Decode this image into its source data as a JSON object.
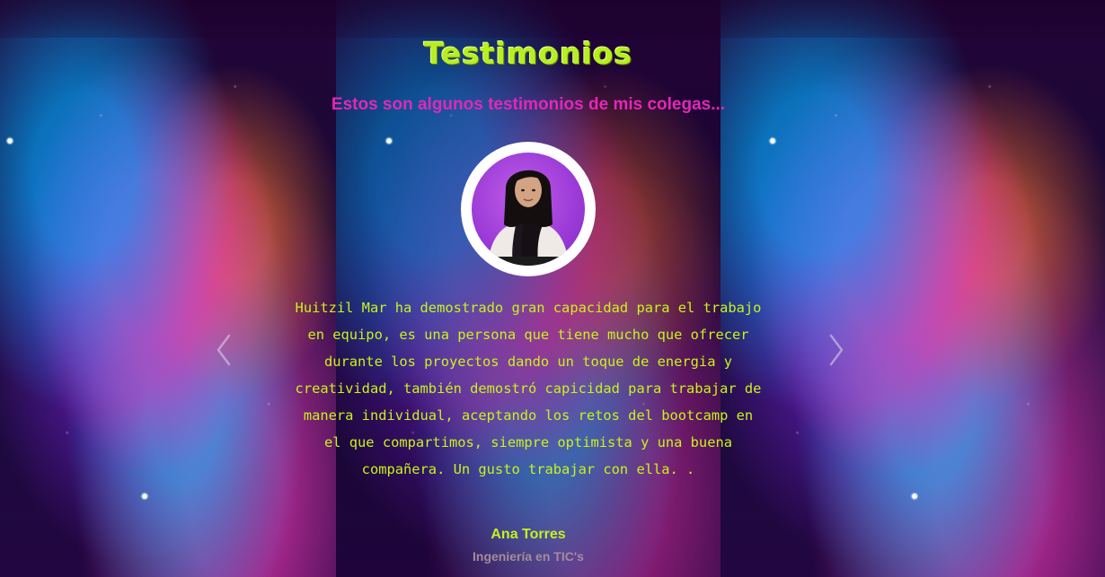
{
  "section": {
    "title": "Testimonios",
    "subtitle": "Estos son algunos testimonios de mis colegas..."
  },
  "testimonial": {
    "quote": "Huitzil Mar ha demostrado gran capacidad para el trabajo en equipo, es una persona que tiene mucho que ofrecer durante los proyectos dando un toque de energia y creatividad, también demostró capicidad para trabajar de manera individual, aceptando los retos del bootcamp en el que compartimos, siempre optimista y una buena compañera. Un gusto trabajar con ella. .",
    "name": "Ana Torres",
    "role": "Ingeniería en TIC's"
  },
  "carousel": {
    "prev_icon": "chevron-left-icon",
    "next_icon": "chevron-right-icon"
  },
  "colors": {
    "title": "#b7ee24",
    "subtitle": "#e327b8",
    "quote": "#c9f21c",
    "role": "#a48c9a"
  }
}
